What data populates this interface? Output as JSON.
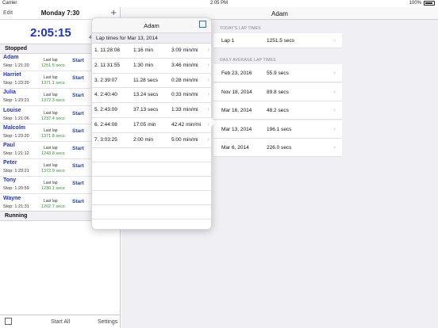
{
  "status_bar": {
    "carrier": "Carrier",
    "time": "2:05 PM",
    "battery": "100%"
  },
  "left": {
    "edit": "Edit",
    "title": "Monday 7:30",
    "add_icon": "plus-icon",
    "clock": "2:05:15",
    "clock_partial": "4",
    "section_stopped": "Stopped",
    "section_running": "Running",
    "last_lap_label": "Last lap",
    "start_label": "Start",
    "runners": [
      {
        "name": "Adam",
        "stop": "Stop: 1:21:20",
        "last": "1251.5 secs"
      },
      {
        "name": "Harriet",
        "stop": "Stop: 1:23:20",
        "last": "1371.1 secs"
      },
      {
        "name": "Julia",
        "stop": "Stop: 1:23:21",
        "last": "1372.3 secs"
      },
      {
        "name": "Louise",
        "stop": "Stop: 1:21:06",
        "last": "1237.4 secs"
      },
      {
        "name": "Malcolm",
        "stop": "Stop: 1:23:20",
        "last": "1371.8 secs"
      },
      {
        "name": "Paul",
        "stop": "Stop: 1:21:12",
        "last": "1243.8 secs"
      },
      {
        "name": "Peter",
        "stop": "Stop: 1:23:21",
        "last": "1372.9 secs"
      },
      {
        "name": "Tony",
        "stop": "Stop: 1:20:59",
        "last": "1230.1 secs"
      },
      {
        "name": "Wayne",
        "stop": "Stop: 1:21:31",
        "last": "1262.7 secs"
      }
    ],
    "bottom": {
      "compose_icon": "compose-icon",
      "start_all": "Start All",
      "settings": "Settings"
    }
  },
  "right": {
    "title": "Adam",
    "todays_header": "TODAY'S LAP TIMES",
    "todays": [
      {
        "a": "Lap 1",
        "b": "1251.5 secs"
      }
    ],
    "daily_header": "DAILY AVERAGE LAP TIMES",
    "daily": [
      {
        "a": "Feb 23, 2016",
        "b": "55.9 secs"
      },
      {
        "a": "Nov 18, 2014",
        "b": "89.8 secs"
      },
      {
        "a": "Mar 16, 2014",
        "b": "48.2 secs"
      },
      {
        "a": "Mar 13, 2014",
        "b": "196.1 secs"
      },
      {
        "a": "Mar 6, 2014",
        "b": "226.0 secs"
      }
    ]
  },
  "popover": {
    "title": "Adam",
    "edit_icon": "compose-icon",
    "subtitle": "Lap times for Mar 13, 2014",
    "laps": [
      {
        "lap": "1. 11:28:08",
        "dur": "1:16 min",
        "pace": "3:09 min/mi"
      },
      {
        "lap": "2. 11:31:55",
        "dur": "1:30 min",
        "pace": "3:46 min/mi"
      },
      {
        "lap": "3. 2:39:07",
        "dur": "11.28 secs",
        "pace": "0:28 min/mi"
      },
      {
        "lap": "4. 2:40:40",
        "dur": "13.24 secs",
        "pace": "0:33 min/mi"
      },
      {
        "lap": "5. 2:43:09",
        "dur": "37.13 secs",
        "pace": "1:33 min/mi"
      },
      {
        "lap": "6. 2:44:08",
        "dur": "17:05 min",
        "pace": "42:42 min/mi"
      },
      {
        "lap": "7. 3:03:25",
        "dur": "2:00 min",
        "pace": "5:00 min/mi"
      }
    ]
  }
}
